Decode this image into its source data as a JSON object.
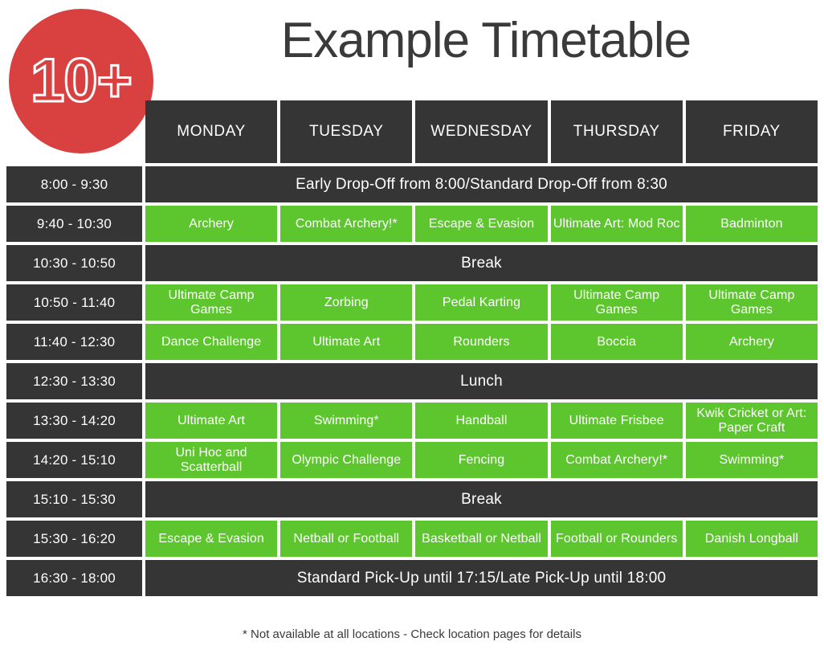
{
  "badge": {
    "label": "10+"
  },
  "title": "Example Timetable",
  "colors": {
    "green": "#5dc62f",
    "dark": "#353535",
    "red": "#d94040",
    "white": "#ffffff"
  },
  "header": {
    "corner": "",
    "days": [
      "MONDAY",
      "TUESDAY",
      "WEDNESDAY",
      "THURSDAY",
      "FRIDAY"
    ]
  },
  "rows": [
    {
      "time": "8:00 - 9:30",
      "type": "span",
      "span_text": "Early Drop-Off from 8:00/Standard Drop-Off from 8:30"
    },
    {
      "time": "9:40 - 10:30",
      "type": "activities",
      "cells": [
        "Archery",
        "Combat Archery!*",
        "Escape & Evasion",
        "Ultimate Art: Mod Roc",
        "Badminton"
      ]
    },
    {
      "time": "10:30 - 10:50",
      "type": "span",
      "span_text": "Break"
    },
    {
      "time": "10:50 - 11:40",
      "type": "activities",
      "cells": [
        "Ultimate Camp Games",
        "Zorbing",
        "Pedal Karting",
        "Ultimate Camp Games",
        "Ultimate Camp Games"
      ]
    },
    {
      "time": "11:40 - 12:30",
      "type": "activities",
      "cells": [
        "Dance Challenge",
        "Ultimate Art",
        "Rounders",
        "Boccia",
        "Archery"
      ]
    },
    {
      "time": "12:30 - 13:30",
      "type": "span",
      "span_text": "Lunch"
    },
    {
      "time": "13:30 - 14:20",
      "type": "activities",
      "cells": [
        "Ultimate Art",
        "Swimming*",
        "Handball",
        "Ultimate Frisbee",
        "Kwik Cricket or Art: Paper Craft"
      ]
    },
    {
      "time": "14:20 - 15:10",
      "type": "activities",
      "cells": [
        "Uni Hoc and Scatterball",
        "Olympic Challenge",
        "Fencing",
        "Combat Archery!*",
        "Swimming*"
      ]
    },
    {
      "time": "15:10 - 15:30",
      "type": "span",
      "span_text": "Break"
    },
    {
      "time": "15:30 - 16:20",
      "type": "activities",
      "cells": [
        "Escape & Evasion",
        "Netball or Football",
        "Basketball or Netball",
        "Football or Rounders",
        "Danish Longball"
      ]
    },
    {
      "time": "16:30 - 18:00",
      "type": "span",
      "span_text": "Standard Pick-Up until 17:15/Late Pick-Up until 18:00"
    }
  ],
  "footnote": "* Not available at all locations - Check location pages for details"
}
